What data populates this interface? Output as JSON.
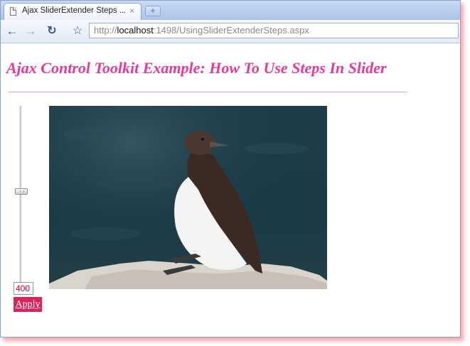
{
  "browser": {
    "tab_title": "Ajax SliderExtender Steps ...",
    "tab_close": "×",
    "new_tab": "+",
    "url_prefix": "http://",
    "url_host": "localhost",
    "url_path": ":1498/UsingSliderExtenderSteps.aspx",
    "icons": [
      "page-icon",
      "close-icon",
      "back-icon",
      "forward-icon",
      "reload-icon",
      "star-icon"
    ]
  },
  "page": {
    "title": "Ajax Control Toolkit Example: How To Use Steps In Slider",
    "accent_color": "#e83a98",
    "slider": {
      "value_text": "400",
      "level_fraction": 0.5
    },
    "apply_label": "Apply",
    "photo": "penguin-like seabird on rock"
  }
}
